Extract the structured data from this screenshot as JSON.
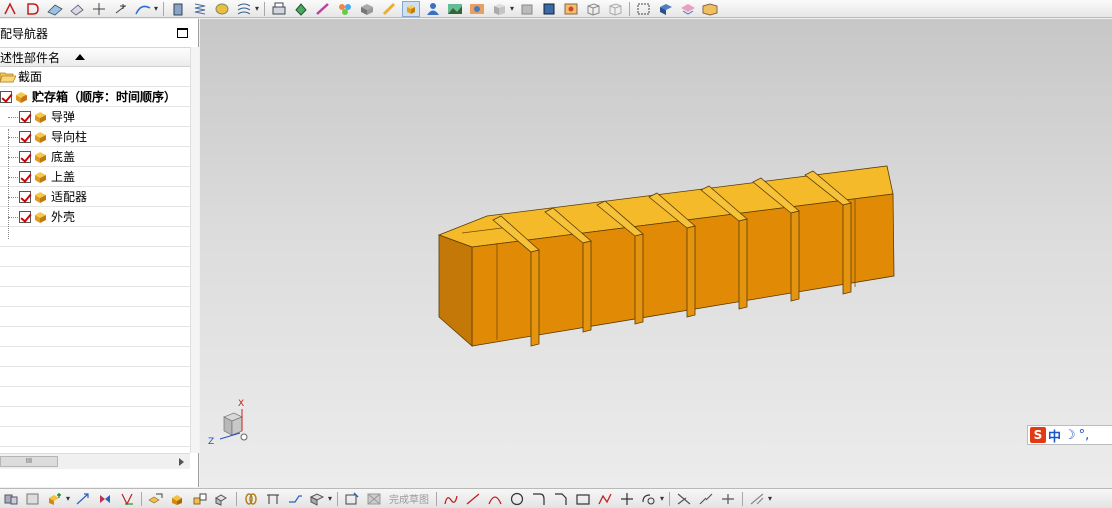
{
  "navigator": {
    "title": "装配导航器",
    "title_visible": "配导航器",
    "column_header": "描述性部件名",
    "column_header_visible": "述性部件名"
  },
  "tree": {
    "folder": {
      "label": "截面"
    },
    "assembly": {
      "label": "贮存箱（顺序：时间顺序）",
      "checked": true
    },
    "parts": [
      {
        "label": "导弹",
        "checked": true
      },
      {
        "label": "导向柱",
        "checked": true
      },
      {
        "label": "底盖",
        "checked": true
      },
      {
        "label": "上盖",
        "checked": true
      },
      {
        "label": "适配器",
        "checked": true
      },
      {
        "label": "外壳",
        "checked": true
      }
    ]
  },
  "scrollbar": {
    "thumb_label": "III"
  },
  "bottom_toolbar": {
    "sketch_label": "完成草图"
  },
  "triad": {
    "x_label": "X",
    "z_label": "Z"
  },
  "ime": {
    "logo": "S",
    "mode": "中",
    "moon": "☽",
    "punc": "°,"
  },
  "colors": {
    "box_top": "#F4BA2A",
    "box_front": "#E08A06",
    "box_side": "#C47808",
    "check": "#D00000",
    "toolbar_bg": "#ECECEC"
  }
}
